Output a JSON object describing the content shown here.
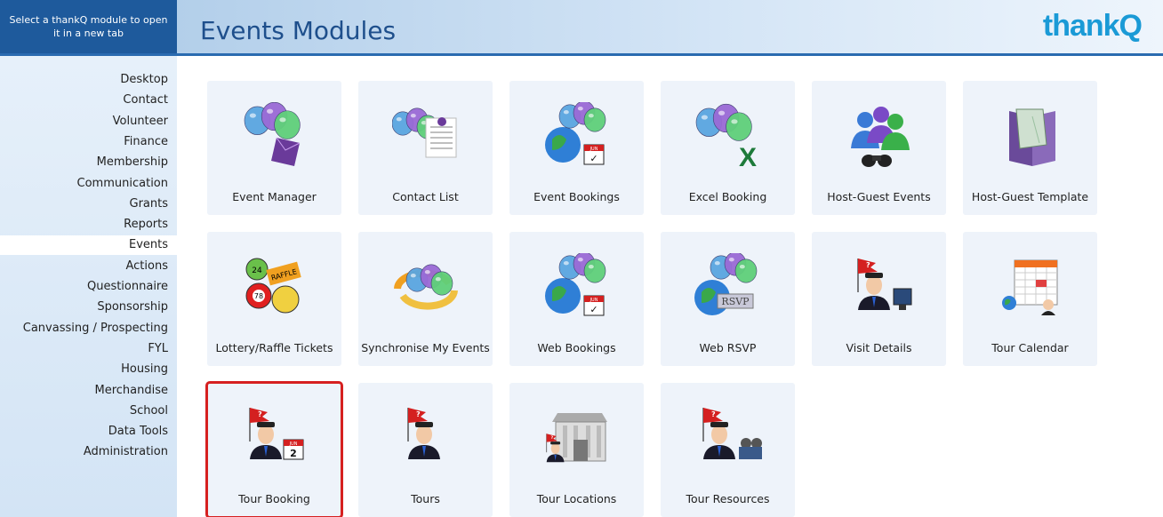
{
  "header": {
    "hint": "Select a thankQ module to open it in a new tab",
    "title": "Events Modules",
    "logo": "thankQ"
  },
  "sidebar": {
    "active": "Events",
    "items": [
      {
        "label": "Desktop"
      },
      {
        "label": "Contact"
      },
      {
        "label": "Volunteer"
      },
      {
        "label": "Finance"
      },
      {
        "label": "Membership"
      },
      {
        "label": "Communication"
      },
      {
        "label": "Grants"
      },
      {
        "label": "Reports"
      },
      {
        "label": "Events"
      },
      {
        "label": "Actions"
      },
      {
        "label": "Questionnaire"
      },
      {
        "label": "Sponsorship"
      },
      {
        "label": "Canvassing / Prospecting"
      },
      {
        "label": "FYL"
      },
      {
        "label": "Housing"
      },
      {
        "label": "Merchandise"
      },
      {
        "label": "School"
      },
      {
        "label": "Data Tools"
      },
      {
        "label": "Administration"
      }
    ]
  },
  "modules": [
    {
      "label": "Event Manager",
      "icon": "balloons-envelope-icon"
    },
    {
      "label": "Contact List",
      "icon": "balloons-list-icon"
    },
    {
      "label": "Event Bookings",
      "icon": "globe-balloons-calendar-icon"
    },
    {
      "label": "Excel Booking",
      "icon": "balloons-excel-icon"
    },
    {
      "label": "Host-Guest Events",
      "icon": "people-binoculars-icon"
    },
    {
      "label": "Host-Guest Template",
      "icon": "event-template-icon"
    },
    {
      "label": "Lottery/Raffle Tickets",
      "icon": "lottery-balls-icon"
    },
    {
      "label": "Synchronise My Events",
      "icon": "sync-balloons-icon"
    },
    {
      "label": "Web Bookings",
      "icon": "globe-balloons-calendar-icon"
    },
    {
      "label": "Web RSVP",
      "icon": "globe-balloons-rsvp-icon"
    },
    {
      "label": "Visit Details",
      "icon": "guide-monitor-icon"
    },
    {
      "label": "Tour Calendar",
      "icon": "tour-calendar-icon"
    },
    {
      "label": "Tour Booking",
      "icon": "guide-calendar-icon",
      "selected": true
    },
    {
      "label": "Tours",
      "icon": "tour-guide-icon"
    },
    {
      "label": "Tour Locations",
      "icon": "building-guide-icon"
    },
    {
      "label": "Tour Resources",
      "icon": "guide-projector-icon"
    }
  ],
  "colors": {
    "header_left": "#1e5a9c",
    "title": "#1e4f8c",
    "logo": "#1a9ad6",
    "tile_bg": "#eef3fa",
    "selection": "#d62020"
  }
}
